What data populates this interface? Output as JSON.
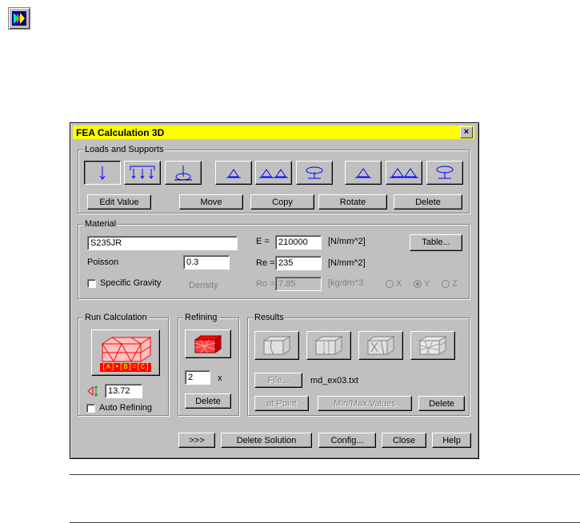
{
  "dialog": {
    "title": "FEA Calculation 3D",
    "close_label": "×"
  },
  "loads": {
    "group_label": "Loads and Supports",
    "icons": [
      "arrow-down-icon",
      "distributed-load-icon",
      "moment-load-icon",
      "pin-support-icon",
      "pin-roller-support-icon",
      "fixed-support-icon",
      "pin-support-alt-icon",
      "roller-support-icon",
      "fixed-support-alt-icon"
    ],
    "edit_value": "Edit Value",
    "move": "Move",
    "copy": "Copy",
    "rotate": "Rotate",
    "delete": "Delete"
  },
  "material": {
    "group_label": "Material",
    "name": "S235JR",
    "poisson_label": "Poisson",
    "poisson": "0.3",
    "specific_gravity_label": "Specific Gravity",
    "density_label": "Density",
    "e_label": "E =",
    "e_value": "210000",
    "e_unit": "[N/mm^2]",
    "re_label": "Re =",
    "re_value": "235",
    "re_unit": "[N/mm^2]",
    "ro_label": "Ro =",
    "ro_value": "7.85",
    "ro_unit": "[kg/dm^3",
    "table_button": "Table...",
    "axis_x": "X",
    "axis_y": "Y",
    "axis_z": "Z"
  },
  "run": {
    "group_label": "Run Calculation",
    "formula": "[A]•[B]=[C]",
    "scale_value": "13.72",
    "auto_refining_label": "Auto Refining"
  },
  "refining": {
    "group_label": "Refining",
    "factor": "2",
    "factor_unit": "x",
    "delete": "Delete"
  },
  "results": {
    "group_label": "Results",
    "file_button": "File...",
    "file_name": "md_ex03.txt",
    "at_point": "at Point",
    "minmax": "Min/Max Values",
    "delete": "Delete"
  },
  "footer": {
    "more": ">>>",
    "delete_solution": "Delete Solution",
    "config": "Config...",
    "close": "Close",
    "help": "Help"
  },
  "colors": {
    "titlebar": "#ffff00",
    "face": "#c0c0c0",
    "icon_blue": "#0000ff",
    "mesh_red": "#ff0000"
  }
}
